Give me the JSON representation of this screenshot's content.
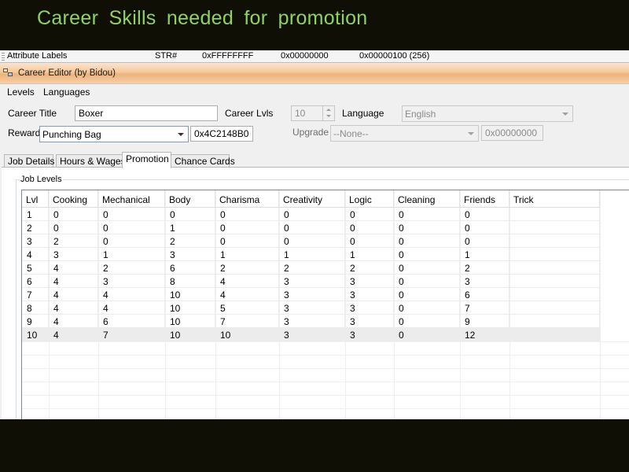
{
  "slide": {
    "title": "Career Skills needed for promotion"
  },
  "attribute_strip": {
    "label": "Attribute Labels",
    "col1": "STR#",
    "col2": "0xFFFFFFFF",
    "col3": "0x00000000",
    "col4": "0x00000100 (256)"
  },
  "window": {
    "title": "Career Editor (by Bidou)"
  },
  "menu": {
    "items": [
      "Levels",
      "Languages"
    ]
  },
  "form": {
    "career_title_label": "Career Title",
    "career_title_value": "Boxer",
    "career_lvls_label": "Career Lvls",
    "career_lvls_value": "10",
    "language_label": "Language",
    "language_value": "English",
    "reward_label": "Reward",
    "reward_value": "Punching Bag",
    "reward_hex": "0x4C2148B0",
    "upgrade_label": "Upgrade",
    "upgrade_value": "--None--",
    "upgrade_hex": "0x00000000"
  },
  "tabs": [
    "Job Details",
    "Hours & Wages",
    "Promotion",
    "Chance Cards"
  ],
  "active_tab": "Promotion",
  "group": {
    "label": "Job Levels"
  },
  "grid": {
    "columns": [
      "Lvl",
      "Cooking",
      "Mechanical",
      "Body",
      "Charisma",
      "Creativity",
      "Logic",
      "Cleaning",
      "Friends",
      "Trick"
    ],
    "rows": [
      [
        "1",
        "0",
        "0",
        "0",
        "0",
        "0",
        "0",
        "0",
        "0",
        ""
      ],
      [
        "2",
        "0",
        "0",
        "1",
        "0",
        "0",
        "0",
        "0",
        "0",
        ""
      ],
      [
        "3",
        "2",
        "0",
        "2",
        "0",
        "0",
        "0",
        "0",
        "0",
        ""
      ],
      [
        "4",
        "3",
        "1",
        "3",
        "1",
        "1",
        "1",
        "0",
        "1",
        ""
      ],
      [
        "5",
        "4",
        "2",
        "6",
        "2",
        "2",
        "2",
        "0",
        "2",
        ""
      ],
      [
        "6",
        "4",
        "3",
        "8",
        "4",
        "3",
        "3",
        "0",
        "3",
        ""
      ],
      [
        "7",
        "4",
        "4",
        "10",
        "4",
        "3",
        "3",
        "0",
        "6",
        ""
      ],
      [
        "8",
        "4",
        "4",
        "10",
        "5",
        "3",
        "3",
        "0",
        "7",
        ""
      ],
      [
        "9",
        "4",
        "6",
        "10",
        "7",
        "3",
        "3",
        "0",
        "9",
        ""
      ],
      [
        "10",
        "4",
        "7",
        "10",
        "10",
        "3",
        "3",
        "0",
        "12",
        ""
      ]
    ],
    "selected_row": 9
  },
  "colors": {
    "slide_title": "#8fd35a",
    "slide_bg": "#0f0f05",
    "titlebar": "#f5c898"
  }
}
